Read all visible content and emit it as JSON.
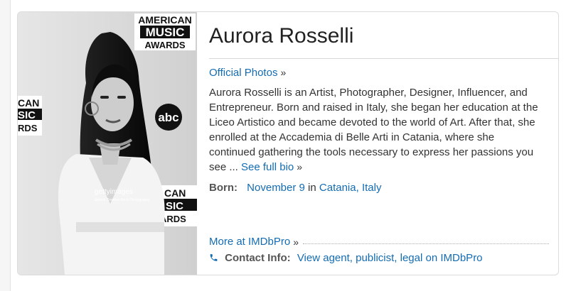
{
  "person": {
    "name": "Aurora Rosselli",
    "official_photos": "Official Photos",
    "bio": "Aurora Rosselli is an Artist, Photographer, Designer, Influencer, and Entrepreneur. Born and raised in Italy, she began her education at the Liceo Artistico and became devoted to the world of Art. After that, she enrolled at the Accademia di Belle Arti in Catania, where she continued gathering the tools necessary to express her passions you see ...",
    "see_full_bio": "See full bio",
    "born_label": "Born:",
    "born_date": "November 9",
    "born_in": "in",
    "born_place": "Catania, Italy",
    "more_at": "More at IMDbPro",
    "contact_label": "Contact Info:",
    "contact_link": "View agent, publicist, legal on IMDbPro",
    "raquo": "»"
  },
  "photo": {
    "backdrop_text": [
      "AMERICAN",
      "MUSIC",
      "AWARDS",
      "CAN",
      "SIC",
      "RDS",
      "CAN",
      "SIC",
      "ARDS"
    ],
    "network_logo": "abc",
    "watermark": "gettyimages",
    "watermark_credit": "Splash Creation Art & Photography"
  },
  "colors": {
    "link": "#136cb2",
    "text": "#333333",
    "label": "#555555"
  },
  "icons": {
    "contact": "phone-icon"
  }
}
